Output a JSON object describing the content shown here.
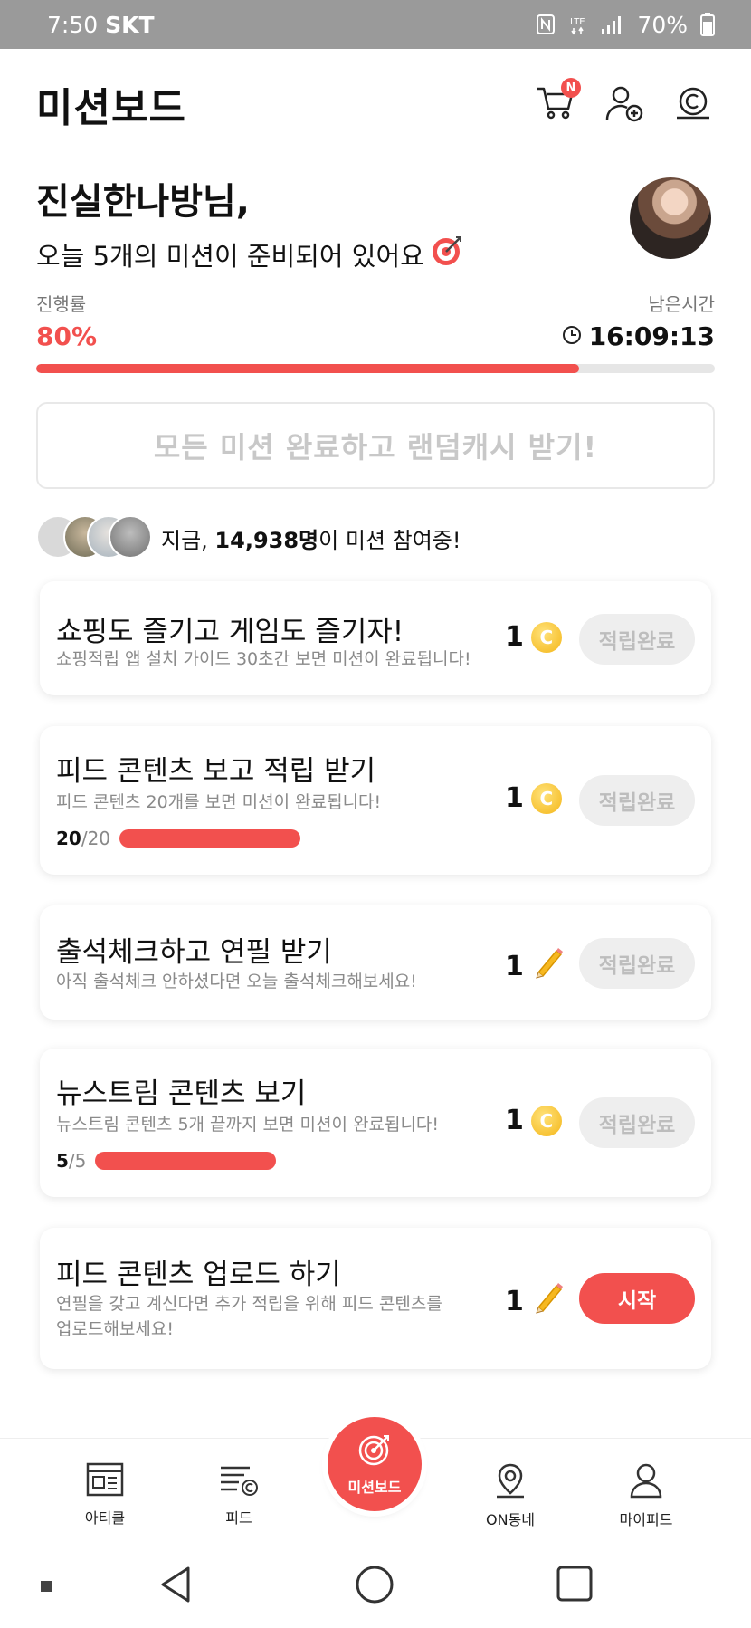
{
  "status": {
    "time": "7:50",
    "carrier": "SKT",
    "battery": "70%"
  },
  "header": {
    "title": "미션보드",
    "cart_badge": "N",
    "icons": [
      "cart-icon",
      "add-friend-icon",
      "cash-coin-icon"
    ]
  },
  "greeting": {
    "name": "진실한나방님,",
    "subtitle": "오늘 5개의 미션이 준비되어 있어요"
  },
  "progress": {
    "label": "진행률",
    "percent_text": "80%",
    "percent": 0.8,
    "remaining_label": "남은시간",
    "remaining_time": "16:09:13"
  },
  "all_missions_button": "모든 미션 완료하고 랜덤캐시 받기!",
  "participants": {
    "prefix": "지금, ",
    "count": "14,938명",
    "suffix": "이 미션 참여중!"
  },
  "missions": [
    {
      "title": "쇼핑도 즐기고 게임도 즐기자!",
      "desc": "쇼핑적립 앱 설치 가이드 30초간 보면 미션이 완료됩니다!",
      "reward": "1",
      "reward_type": "coin-icon",
      "button": "적립완료"
    },
    {
      "title": "피드 콘텐츠 보고 적립 받기",
      "desc": "피드 콘텐츠 20개를 보면 미션이 완료됩니다!",
      "done": "20",
      "total": "/20",
      "fraction": 1.0,
      "reward": "1",
      "reward_type": "coin-icon",
      "button": "적립완료"
    },
    {
      "title": "출석체크하고 연필 받기",
      "desc": "아직 출석체크 안하셨다면 오늘 출석체크해보세요!",
      "reward": "1",
      "reward_type": "pencil-icon",
      "button": "적립완료"
    },
    {
      "title": "뉴스트림 콘텐츠 보기",
      "desc": "뉴스트림 콘텐츠 5개 끝까지 보면 미션이 완료됩니다!",
      "done": "5",
      "total": "/5",
      "fraction": 1.0,
      "reward": "1",
      "reward_type": "coin-icon",
      "button": "적립완료"
    },
    {
      "title": "피드 콘텐츠 업로드 하기",
      "desc": "연필을 갖고 계신다면 추가 적립을 위해 피드 콘텐츠를 업로드해보세요!",
      "reward": "1",
      "reward_type": "pencil-icon",
      "button": "시작"
    }
  ],
  "nav": {
    "article": "아티클",
    "feed": "피드",
    "mission": "미션보드",
    "on": "ON동네",
    "my": "마이피드"
  },
  "colors": {
    "accent": "#f2504e",
    "coin": "#f4b618"
  }
}
